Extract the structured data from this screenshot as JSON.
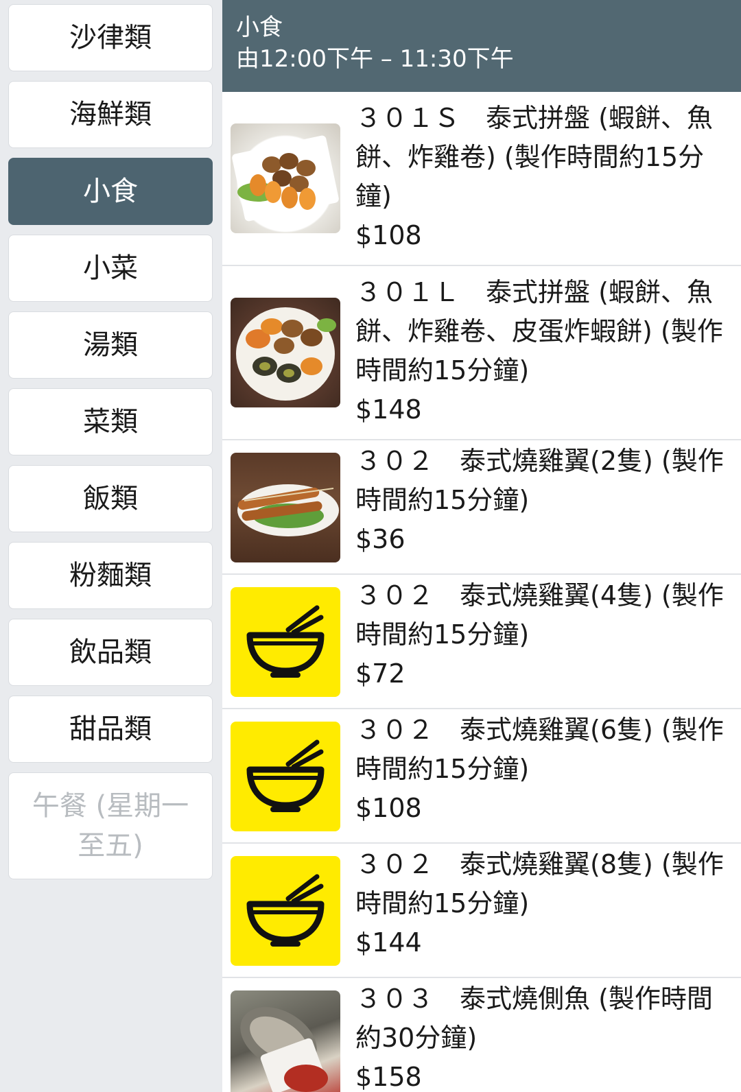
{
  "sidebar": {
    "categories": [
      {
        "label": "沙律類",
        "state": "normal"
      },
      {
        "label": "海鮮類",
        "state": "normal"
      },
      {
        "label": "小食",
        "state": "active"
      },
      {
        "label": "小菜",
        "state": "normal"
      },
      {
        "label": "湯類",
        "state": "normal"
      },
      {
        "label": "菜類",
        "state": "normal"
      },
      {
        "label": "飯類",
        "state": "normal"
      },
      {
        "label": "粉麵類",
        "state": "normal"
      },
      {
        "label": "飲品類",
        "state": "normal"
      },
      {
        "label": "甜品類",
        "state": "normal"
      },
      {
        "label": "午餐 (星期一至五)",
        "state": "disabled"
      }
    ]
  },
  "header": {
    "title": "小食",
    "hours": "由12:00下午 – 11:30下午"
  },
  "items": [
    {
      "name": "３０１Ｓ　泰式拼盤 (蝦餅、魚餅、炸雞卷) (製作時間約15分鐘)",
      "price": "$108",
      "image": "food-photo"
    },
    {
      "name": "３０１Ｌ　泰式拼盤 (蝦餅、魚餅、炸雞卷、皮蛋炸蝦餅) (製作時間約15分鐘)",
      "price": "$148",
      "image": "food-photo"
    },
    {
      "name": "３０２　泰式燒雞翼(2隻) (製作時間約15分鐘)",
      "price": "$36",
      "image": "food-photo"
    },
    {
      "name": "３０２　泰式燒雞翼(4隻) (製作時間約15分鐘)",
      "price": "$72",
      "image": "bowl-icon"
    },
    {
      "name": "３０２　泰式燒雞翼(6隻) (製作時間約15分鐘)",
      "price": "$108",
      "image": "bowl-icon"
    },
    {
      "name": "３０２　泰式燒雞翼(8隻) (製作時間約15分鐘)",
      "price": "$144",
      "image": "bowl-icon"
    },
    {
      "name": "３０３　泰式燒側魚 (製作時間約30分鐘)",
      "price": "$158",
      "image": "food-photo"
    }
  ],
  "colors": {
    "active_category": "#4d6470",
    "header": "#526872",
    "placeholder_bg": "#ffeb00",
    "disabled_text": "#b8bcc0"
  }
}
